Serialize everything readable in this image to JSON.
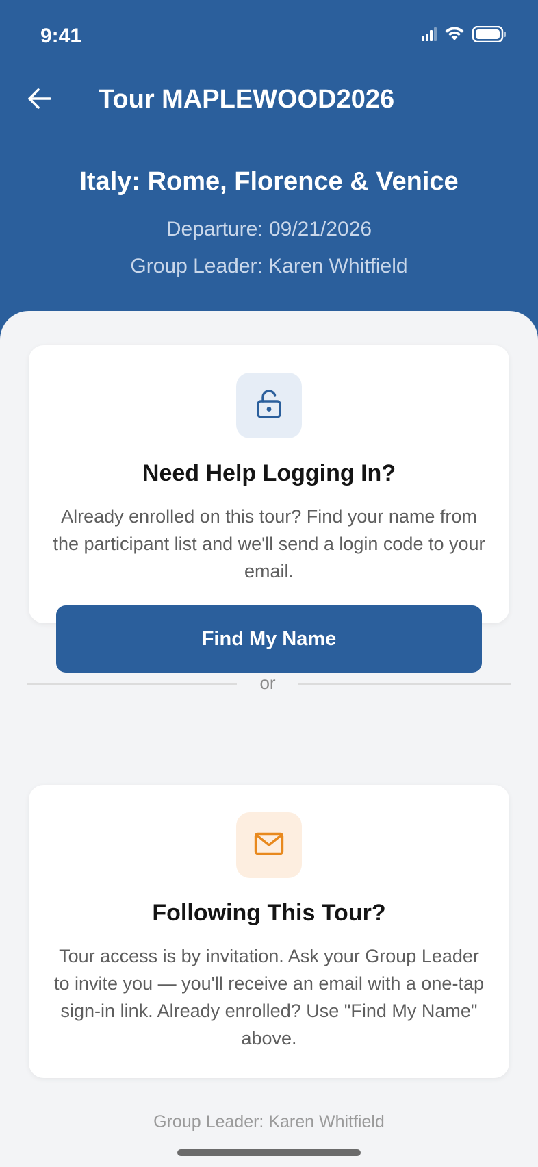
{
  "status_bar": {
    "time": "9:41",
    "icons": [
      "signal-icon",
      "wifi-icon",
      "battery-icon"
    ]
  },
  "nav": {
    "back_icon": "arrow-left-icon",
    "title": "Tour MAPLEWOOD2026"
  },
  "tour": {
    "name": "Italy: Rome, Florence & Venice",
    "departure": "Departure: 09/21/2026",
    "group_leader": "Group Leader: Karen Whitfield"
  },
  "login_help_card": {
    "icon": "unlock-icon",
    "heading": "Need Help Logging In?",
    "body": "Already enrolled on this tour? Find your name from the participant list and we'll send a login code to your email.",
    "button_label": "Find My Name"
  },
  "divider": {
    "label": "or"
  },
  "follow_card": {
    "icon": "mail-icon",
    "heading": "Following This Tour?",
    "body": "Tour access is by invitation. Ask your Group Leader to invite you — you'll receive an email with a one-tap sign-in link. Already enrolled? Use \"Find My Name\" above."
  },
  "footer": {
    "text": "Group Leader: Karen Whitfield"
  },
  "colors": {
    "brand_blue": "#2b5f9c",
    "accent_orange": "#e8891e",
    "background": "#f3f4f6"
  }
}
